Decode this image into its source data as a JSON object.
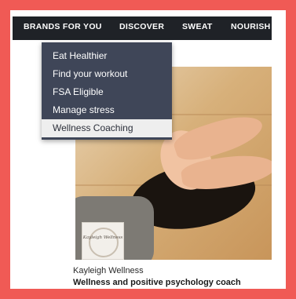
{
  "topnav": {
    "items": [
      "BRANDS FOR YOU",
      "DISCOVER",
      "SWEAT",
      "NOURISH"
    ]
  },
  "dropdown": {
    "items": [
      "Eat Healthier",
      "Find your workout",
      "FSA Eligible",
      "Manage stress",
      "Wellness Coaching"
    ],
    "highlighted": "Wellness Coaching"
  },
  "card": {
    "logo_text": "Kayleigh Wellness",
    "brand_name": "Kayleigh Wellness",
    "description": "Wellness and positive psychology coach"
  },
  "colors": {
    "frame": "#f05a55",
    "nav_bg": "#1f2227",
    "dropdown_bg": "#3f4658",
    "dropdown_active": "#eeeeee"
  }
}
